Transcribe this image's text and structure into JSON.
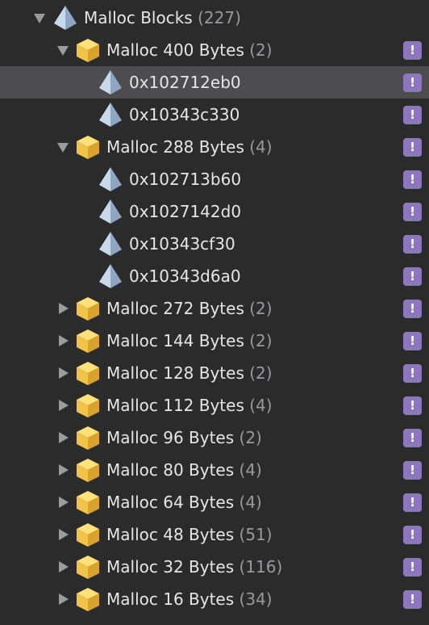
{
  "colors": {
    "background": "#2b2b2c",
    "selected_row": "#4d4d4f",
    "text": "#e6e6e6",
    "count_text": "#9a9a9c",
    "warning_badge": "#8d76be",
    "category_icon": "#f2c24a"
  },
  "tree": {
    "root": {
      "name": "Malloc Blocks",
      "count": "(227)",
      "icon": "pyramid-icon",
      "expanded": true
    },
    "rows": [
      {
        "kind": "category",
        "label": "Malloc 400 Bytes",
        "count": "(2)",
        "icon": "cube-icon",
        "expanded": true,
        "warning": "!",
        "selected": false
      },
      {
        "kind": "block",
        "label": "0x102712eb0",
        "count": "",
        "icon": "pyramid-icon",
        "warning": "!",
        "selected": true
      },
      {
        "kind": "block",
        "label": "0x10343c330",
        "count": "",
        "icon": "pyramid-icon",
        "warning": "!",
        "selected": false
      },
      {
        "kind": "category",
        "label": "Malloc 288 Bytes",
        "count": "(4)",
        "icon": "cube-icon",
        "expanded": true,
        "warning": "!",
        "selected": false
      },
      {
        "kind": "block",
        "label": "0x102713b60",
        "count": "",
        "icon": "pyramid-icon",
        "warning": "!",
        "selected": false
      },
      {
        "kind": "block",
        "label": "0x1027142d0",
        "count": "",
        "icon": "pyramid-icon",
        "warning": "!",
        "selected": false
      },
      {
        "kind": "block",
        "label": "0x10343cf30",
        "count": "",
        "icon": "pyramid-icon",
        "warning": "!",
        "selected": false
      },
      {
        "kind": "block",
        "label": "0x10343d6a0",
        "count": "",
        "icon": "pyramid-icon",
        "warning": "!",
        "selected": false
      },
      {
        "kind": "category",
        "label": "Malloc 272 Bytes",
        "count": "(2)",
        "icon": "cube-icon",
        "expanded": false,
        "warning": "!",
        "selected": false
      },
      {
        "kind": "category",
        "label": "Malloc 144 Bytes",
        "count": "(2)",
        "icon": "cube-icon",
        "expanded": false,
        "warning": "!",
        "selected": false
      },
      {
        "kind": "category",
        "label": "Malloc 128 Bytes",
        "count": "(2)",
        "icon": "cube-icon",
        "expanded": false,
        "warning": "!",
        "selected": false
      },
      {
        "kind": "category",
        "label": "Malloc 112 Bytes",
        "count": "(4)",
        "icon": "cube-icon",
        "expanded": false,
        "warning": "!",
        "selected": false
      },
      {
        "kind": "category",
        "label": "Malloc 96 Bytes",
        "count": "(2)",
        "icon": "cube-icon",
        "expanded": false,
        "warning": "!",
        "selected": false
      },
      {
        "kind": "category",
        "label": "Malloc 80 Bytes",
        "count": "(4)",
        "icon": "cube-icon",
        "expanded": false,
        "warning": "!",
        "selected": false
      },
      {
        "kind": "category",
        "label": "Malloc 64 Bytes",
        "count": "(4)",
        "icon": "cube-icon",
        "expanded": false,
        "warning": "!",
        "selected": false
      },
      {
        "kind": "category",
        "label": "Malloc 48 Bytes",
        "count": "(51)",
        "icon": "cube-icon",
        "expanded": false,
        "warning": "!",
        "selected": false
      },
      {
        "kind": "category",
        "label": "Malloc 32 Bytes",
        "count": "(116)",
        "icon": "cube-icon",
        "expanded": false,
        "warning": "!",
        "selected": false
      },
      {
        "kind": "category",
        "label": "Malloc 16 Bytes",
        "count": "(34)",
        "icon": "cube-icon",
        "expanded": false,
        "warning": "!",
        "selected": false
      }
    ]
  }
}
